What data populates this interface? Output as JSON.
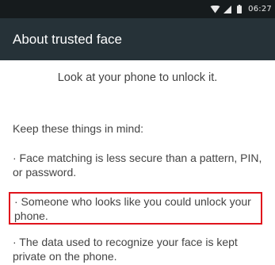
{
  "status_bar": {
    "icons": [
      "wifi-icon",
      "signal-icon",
      "battery-icon"
    ],
    "time": "06:27"
  },
  "app_bar": {
    "title": "About trusted face"
  },
  "content": {
    "lead": "Look at your phone to unlock it.",
    "intro": "Keep these things in mind:",
    "bullets": [
      "· Face matching is less secure than a pattern, PIN, or password.",
      "· Someone who looks like you could unlock your phone.",
      "· The data used to recognize your face is kept private on the phone."
    ]
  },
  "colors": {
    "status_bar": "#161b1d",
    "app_bar": "#263238",
    "highlight": "#e0141c"
  }
}
